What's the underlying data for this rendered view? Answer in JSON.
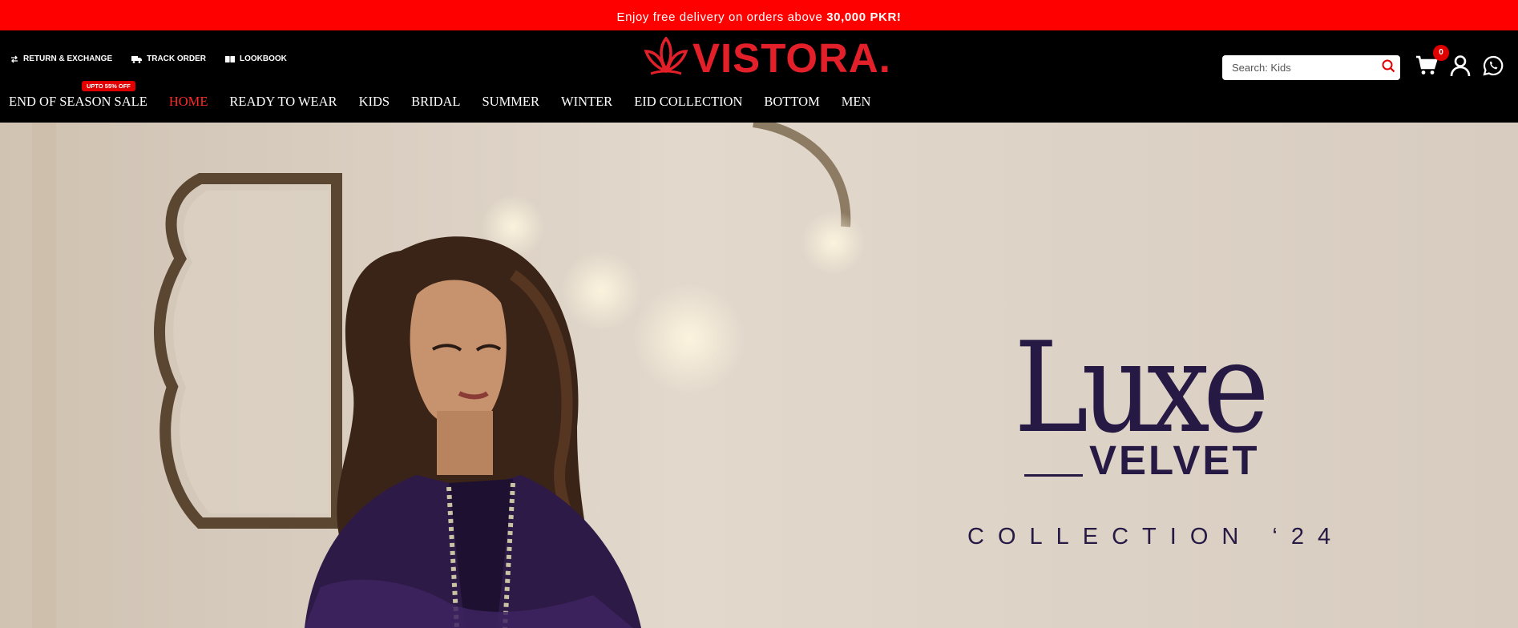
{
  "announcement": {
    "text": "Enjoy free delivery on orders above ",
    "highlight": "30,000 PKR!"
  },
  "utility_links": [
    {
      "label": "RETURN & EXCHANGE",
      "icon": "exchange-arrows-icon"
    },
    {
      "label": "TRACK ORDER",
      "icon": "truck-icon"
    },
    {
      "label": "LOOKBOOK",
      "icon": "book-icon"
    }
  ],
  "logo": {
    "text": "VISTORA.",
    "icon": "lotus-icon",
    "color": "#e3202a"
  },
  "search": {
    "placeholder": "Search: Kids",
    "icon": "search-icon"
  },
  "cart": {
    "count": "0",
    "icon": "cart-icon"
  },
  "account": {
    "icon": "user-icon"
  },
  "whatsapp": {
    "icon": "whatsapp-icon"
  },
  "nav": {
    "sale_badge": "UPTO 55% OFF",
    "items": [
      {
        "label": "END OF SEASON SALE"
      },
      {
        "label": "HOME",
        "active": true
      },
      {
        "label": "READY TO WEAR"
      },
      {
        "label": "KIDS"
      },
      {
        "label": "BRIDAL"
      },
      {
        "label": "SUMMER"
      },
      {
        "label": "WINTER"
      },
      {
        "label": "EID COLLECTION"
      },
      {
        "label": "BOTTOM"
      },
      {
        "label": "MEN"
      }
    ]
  },
  "hero": {
    "title": "Luxe",
    "subtitle": "VELVET",
    "collection": "COLLECTION ‘24",
    "text_color": "#261a45"
  },
  "colors": {
    "accent": "#ff0000",
    "header_bg": "#000000"
  }
}
